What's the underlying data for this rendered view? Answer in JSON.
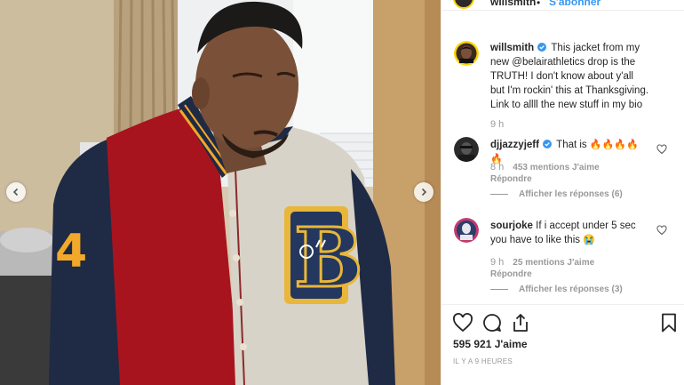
{
  "header": {
    "username": "willsmith",
    "separator": "•",
    "follow_label": "S'abonner"
  },
  "caption": {
    "username": "willsmith",
    "text": "This jacket from my new @belairathletics drop is the TRUTH! I don't know about y'all but I'm rockin' this at Thanksgiving. Link to allll the new stuff in my bio",
    "time": "9 h"
  },
  "comments": [
    {
      "username": "djjazzyjeff",
      "verified": true,
      "text": "That is ",
      "emoji": "🔥🔥🔥🔥🔥",
      "time": "8 h",
      "likes": "453 mentions J'aime",
      "reply_label": "Répondre",
      "view_replies": "Afficher les réponses (6)"
    },
    {
      "username": "sourjoke",
      "verified": false,
      "text": "If i accept under 5 sec you have to like this ",
      "emoji": "😭",
      "time": "9 h",
      "likes": "25 mentions J'aime",
      "reply_label": "Répondre",
      "view_replies": "Afficher les réponses (3)"
    }
  ],
  "post": {
    "like_count": "595 921 J'aime",
    "timestamp": "IL Y A 9 HEURES"
  },
  "icons": {
    "prev": "chevron-left-icon",
    "next": "chevron-right-icon",
    "like": "heart-icon",
    "comment": "comment-icon",
    "share": "share-icon",
    "save": "bookmark-icon"
  },
  "colors": {
    "verified_blue": "#3897f0",
    "jacket_red": "#a8141e",
    "jacket_navy": "#1f2a44",
    "jacket_gold": "#f2a92a",
    "jacket_cream": "#d8d3c8"
  }
}
